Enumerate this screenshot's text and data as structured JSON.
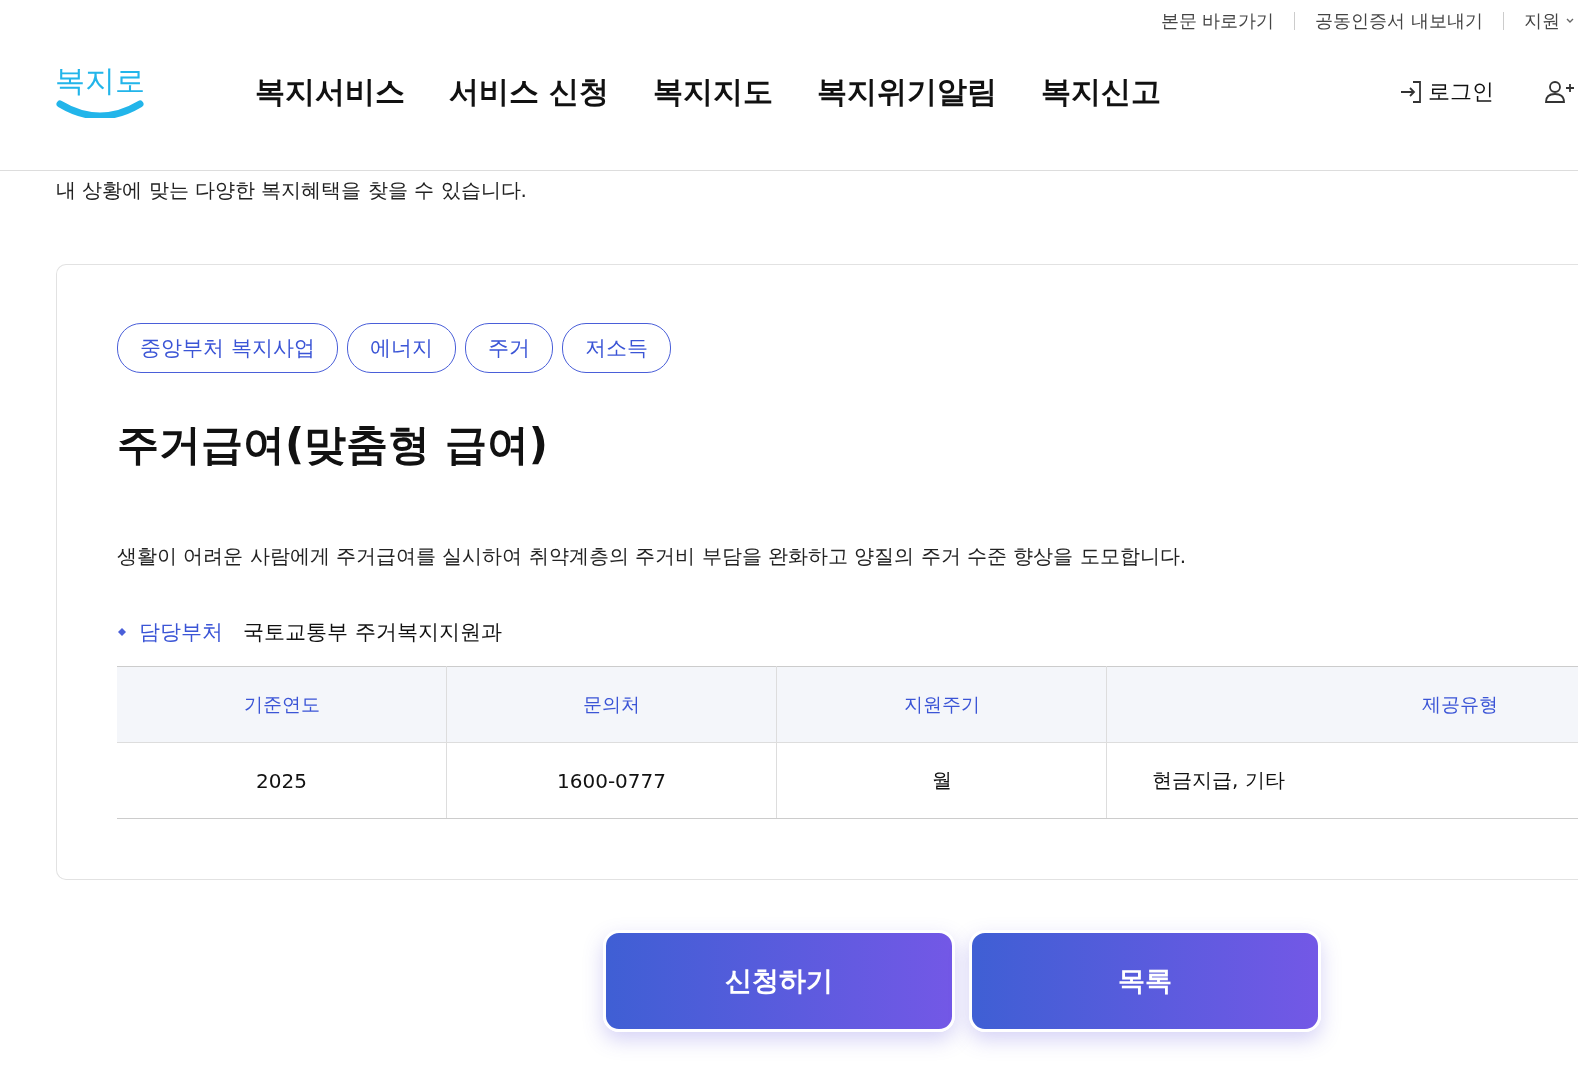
{
  "utility_links": [
    "본문 바로가기",
    "공동인증서 내보내기",
    "지원"
  ],
  "logo": "복지로",
  "nav": [
    "복지서비스",
    "서비스 신청",
    "복지지도",
    "복지위기알림",
    "복지신고"
  ],
  "login": "로그인",
  "intro": "내 상황에 맞는 다양한 복지혜택을 찾을 수 있습니다.",
  "card": {
    "tags": [
      "중앙부처 복지사업",
      "에너지",
      "주거",
      "저소득"
    ],
    "title": "주거급여(맞춤형 급여)",
    "description": "생활이 어려운 사람에게 주거급여를 실시하여 취약계층의 주거비 부담을 완화하고 양질의 주거 수준 향상을 도모합니다.",
    "department_label": "담당부처",
    "department": "국토교통부 주거복지지원과",
    "table": {
      "columns": [
        "기준연도",
        "문의처",
        "지원주기",
        "제공유형"
      ],
      "rows": [
        [
          "2025",
          "1600-0777",
          "월",
          "현금지급, 기타"
        ]
      ]
    }
  },
  "buttons": [
    "신청하기",
    "목록"
  ]
}
